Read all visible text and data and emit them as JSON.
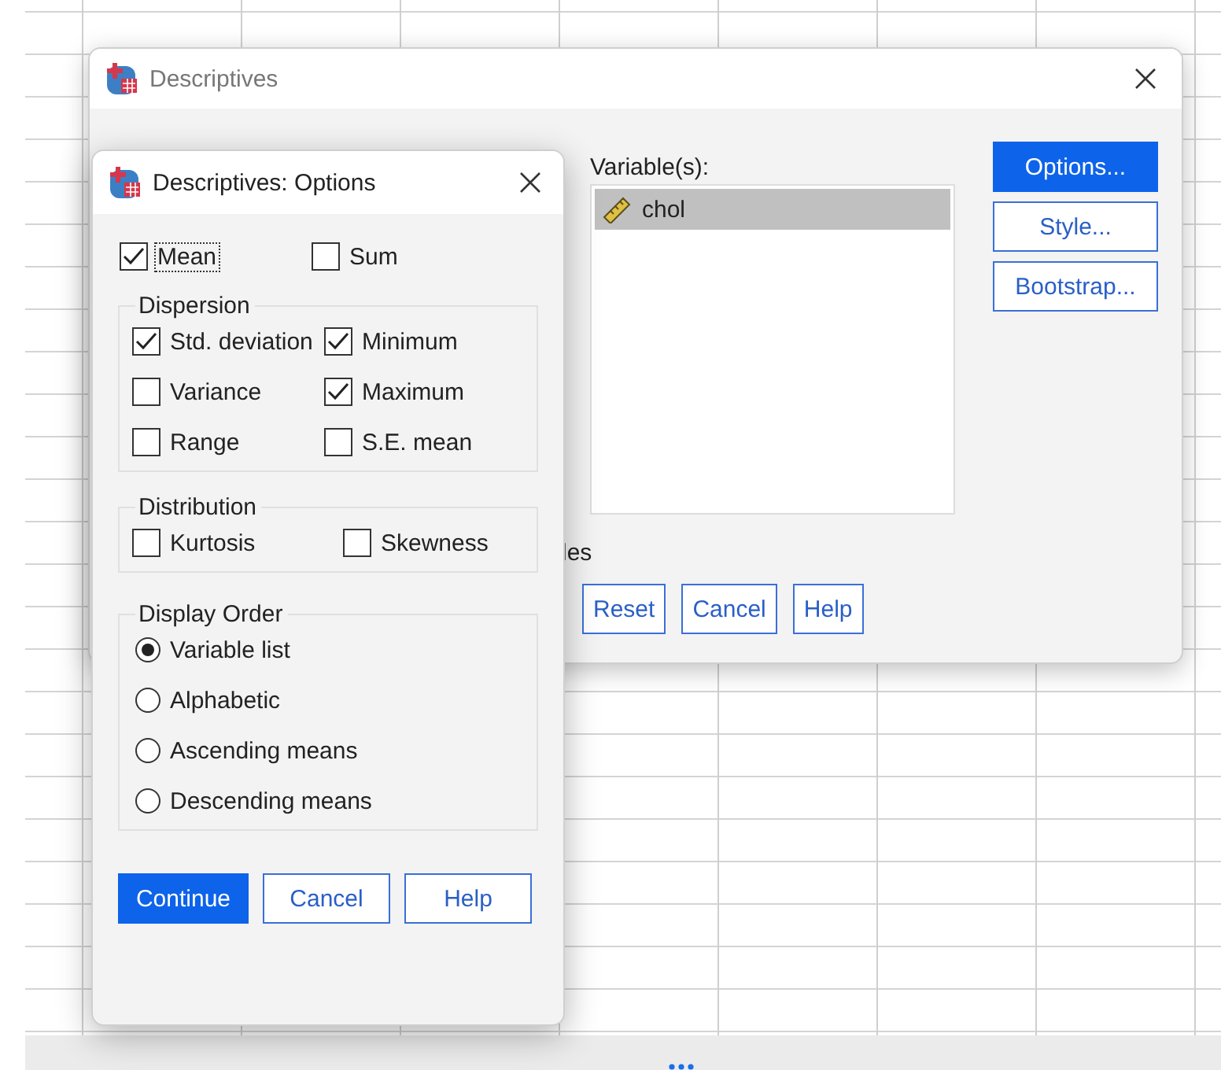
{
  "main_dialog": {
    "title": "Descriptives",
    "variables_label": "Variable(s):",
    "variables": [
      {
        "name": "chol",
        "selected": true
      }
    ],
    "side_buttons": [
      {
        "label": "Options...",
        "default": true
      },
      {
        "label": "Style...",
        "default": false
      },
      {
        "label": "Bootstrap...",
        "default": false
      }
    ],
    "partial_text": "les",
    "bottom_buttons": [
      {
        "label": "Reset",
        "default": false
      },
      {
        "label": "Cancel",
        "default": false
      },
      {
        "label": "Help",
        "default": false
      }
    ]
  },
  "options_dialog": {
    "title": "Descriptives: Options",
    "top_checks": [
      {
        "label": "Mean",
        "checked": true,
        "focused": true
      },
      {
        "label": "Sum",
        "checked": false,
        "focused": false
      }
    ],
    "dispersion": {
      "title": "Dispersion",
      "checks": [
        {
          "label": "Std. deviation",
          "checked": true,
          "focused": false
        },
        {
          "label": "Minimum",
          "checked": true,
          "focused": false
        },
        {
          "label": "Variance",
          "checked": false,
          "focused": false
        },
        {
          "label": "Maximum",
          "checked": true,
          "focused": false
        },
        {
          "label": "Range",
          "checked": false,
          "focused": false
        },
        {
          "label": "S.E. mean",
          "checked": false,
          "focused": false
        }
      ]
    },
    "distribution": {
      "title": "Distribution",
      "checks": [
        {
          "label": "Kurtosis",
          "checked": false,
          "focused": false
        },
        {
          "label": "Skewness",
          "checked": false,
          "focused": false
        }
      ]
    },
    "display_order": {
      "title": "Display Order",
      "options": [
        {
          "label": "Variable list",
          "selected": true
        },
        {
          "label": "Alphabetic",
          "selected": false
        },
        {
          "label": "Ascending means",
          "selected": false
        },
        {
          "label": "Descending means",
          "selected": false
        }
      ]
    },
    "buttons": [
      {
        "label": "Continue",
        "default": true
      },
      {
        "label": "Cancel",
        "default": false
      },
      {
        "label": "Help",
        "default": false
      }
    ]
  }
}
